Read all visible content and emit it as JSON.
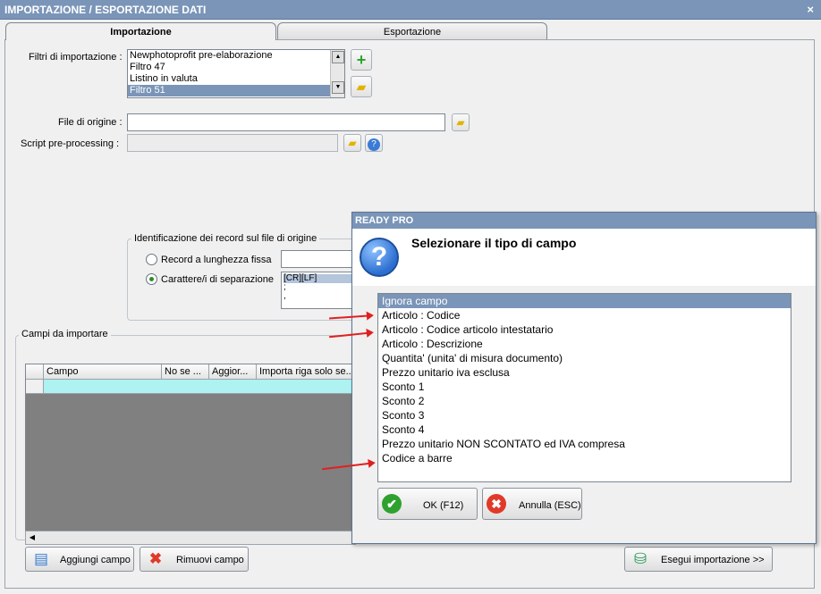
{
  "window": {
    "title": "IMPORTAZIONE / ESPORTAZIONE DATI",
    "close": "×"
  },
  "tabs": [
    {
      "label": "Importazione"
    },
    {
      "label": "Esportazione"
    }
  ],
  "import": {
    "filters_label": "Filtri di importazione :",
    "filters": [
      "Newphotoprofit pre-elaborazione",
      "Filtro 47",
      "Listino in valuta",
      "Filtro 51"
    ],
    "selected_filter": "Filtro 51",
    "origin_file_label": "File di origine :",
    "origin_file_value": "",
    "script_label": "Script pre-processing :",
    "script_value": "",
    "record_group_title": "Identificazione dei record sul file di origine",
    "record_fixed_label": "Record a lunghezza fissa",
    "record_sep_label": "Carattere/i di separazione",
    "separators": [
      "[CR][LF]",
      ";",
      ","
    ],
    "fields_group_title": "Campi da importare",
    "grid_headers": [
      "Campo",
      "No se ...",
      "Aggior...",
      "Importa riga solo se..."
    ],
    "add_field": "Aggiungi campo",
    "remove_field": "Rimuovi campo",
    "run_import": "Esegui importazione >>"
  },
  "dialog": {
    "title": "READY PRO",
    "message": "Selezionare il tipo di campo",
    "items": [
      "Ignora campo",
      "Articolo : Codice",
      "Articolo : Codice articolo intestatario",
      "Articolo : Descrizione",
      "Quantita' (unita' di misura documento)",
      "Prezzo unitario iva esclusa",
      "Sconto 1",
      "Sconto 2",
      "Sconto 3",
      "Sconto 4",
      "Prezzo unitario NON SCONTATO ed IVA compresa",
      "Codice a barre"
    ],
    "ok": "OK (F12)",
    "cancel": "Annulla (ESC)"
  },
  "colors": {
    "titlebar": "#7a95b8",
    "selection": "#7a95b8",
    "grid_row": "#aef2f2",
    "annotation_arrow": "#e02020"
  }
}
